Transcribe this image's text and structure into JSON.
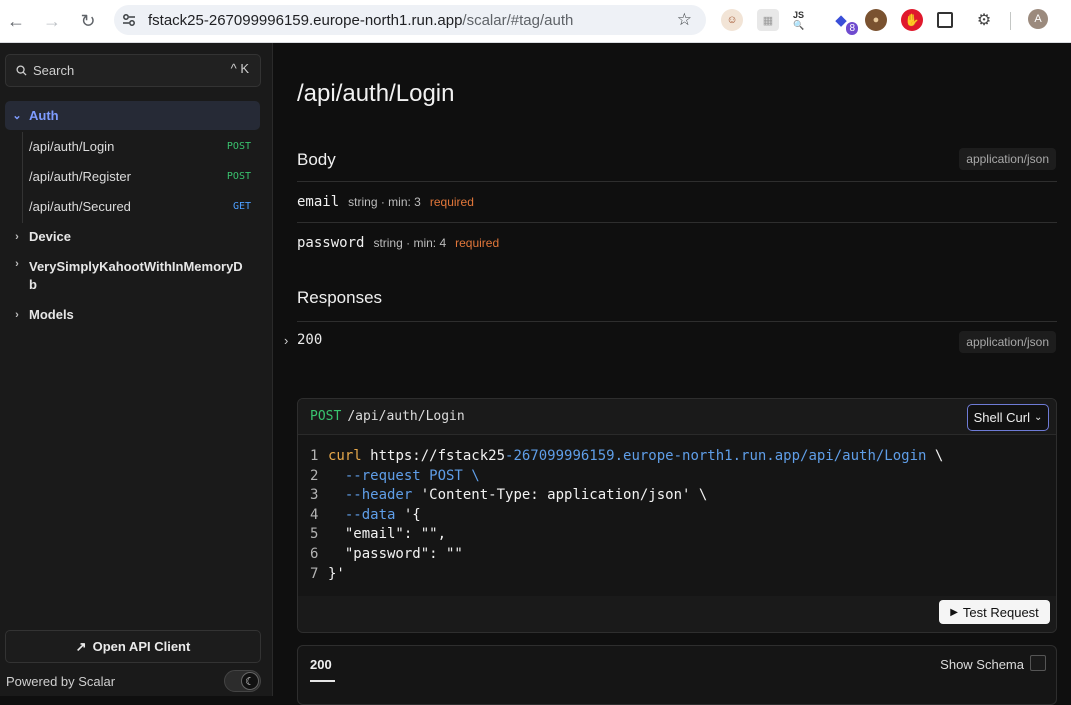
{
  "browser": {
    "url_host": "fstack25-267099996159.europe-north1.run.app",
    "url_path": "/scalar/#tag/auth",
    "extension_badge": "8",
    "profile_initial": "A"
  },
  "sidebar": {
    "search_label": "Search",
    "search_shortcut": "^ K",
    "groups": [
      {
        "label": "Auth"
      },
      {
        "label": "Device"
      },
      {
        "label": "VerySimplyKahootWithInMemoryD",
        "label_cont": "b"
      },
      {
        "label": "Models"
      }
    ],
    "items": [
      {
        "label": "/api/auth/Login",
        "method": "POST"
      },
      {
        "label": "/api/auth/Register",
        "method": "POST"
      },
      {
        "label": "/api/auth/Secured",
        "method": "GET"
      }
    ],
    "open_client_label": "Open API Client",
    "powered_by": "Powered by Scalar"
  },
  "main": {
    "title": "/api/auth/Login",
    "body_title": "Body",
    "body_content_type": "application/json",
    "properties": [
      {
        "name": "email",
        "meta": "string · min: 3",
        "required": "required"
      },
      {
        "name": "password",
        "meta": "string · min: 4",
        "required": "required"
      }
    ],
    "responses_title": "Responses",
    "response_code": "200",
    "response_content_type": "application/json"
  },
  "code_card": {
    "method": "POST",
    "path": "/api/auth/Login",
    "language": "Shell Curl",
    "lines": {
      "l1_cmd": "curl",
      "l1_url_a": "https://fstack25",
      "l1_url_b": "-267099996159.europe-north1.run.app/api/auth/Login",
      "l1_end": " \\",
      "l2_flag": "--request",
      "l2_rest": " POST \\",
      "l3_flag": "--header",
      "l3_rest": " 'Content-Type: application/json' \\",
      "l4_flag": "--data",
      "l4_rest": " '{",
      "l5": "  \"email\": \"\",",
      "l6": "  \"password\": \"\"",
      "l7": "}'"
    },
    "line_numbers": [
      "1",
      "2",
      "3",
      "4",
      "5",
      "6",
      "7"
    ],
    "test_button": "Test Request"
  },
  "response_card": {
    "tab": "200",
    "show_schema": "Show Schema"
  }
}
